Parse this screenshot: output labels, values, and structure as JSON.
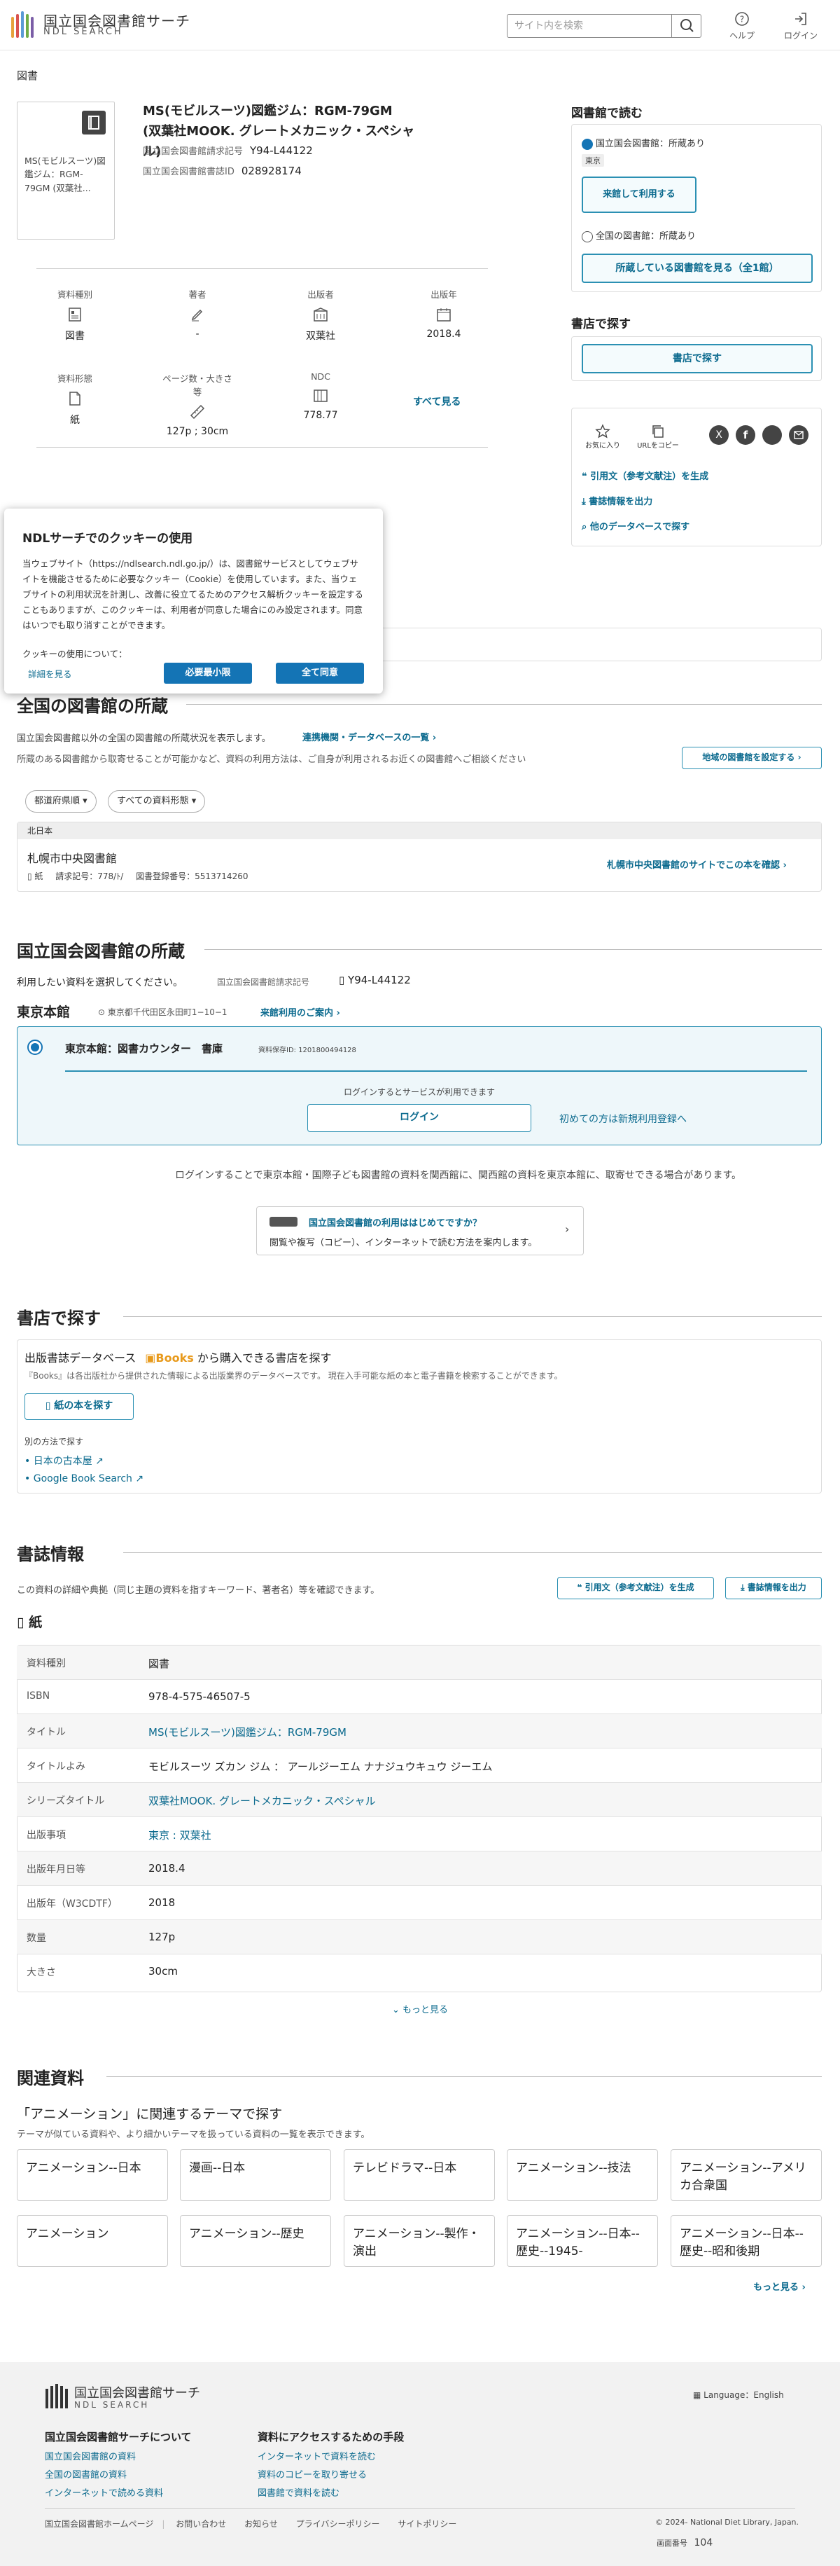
{
  "header": {
    "logo_jp": "国立国会図書館サーチ",
    "logo_en": "NDL SEARCH",
    "search_placeholder": "サイト内を検索",
    "help": "ヘルプ",
    "login": "ログイン"
  },
  "breadcrumb": "図書",
  "book": {
    "cover_text": "MS(モビルスーツ)図鑑ジム：RGM-79GM (双葉社...",
    "title_line1": "MS(モビルスーツ)図鑑ジム：RGM-79GM",
    "title_line2": "(双葉社MOOK. グレートメカニック・スペシャル)",
    "call_label": "国立国会図書館請求記号",
    "call_value": "Y94-L44122",
    "bib_label": "国立国会図書館書誌ID",
    "bib_value": "028928174",
    "attrs": [
      {
        "label": "資料種別",
        "value": "図書",
        "icon": "book-type-icon"
      },
      {
        "label": "著者",
        "value": "-",
        "icon": "pen-icon"
      },
      {
        "label": "出版者",
        "value": "双葉社",
        "icon": "building-icon"
      },
      {
        "label": "出版年",
        "value": "2018.4",
        "icon": "calendar-icon"
      },
      {
        "label": "資料形態",
        "value": "紙",
        "icon": "paper-icon"
      },
      {
        "label": "ページ数・大きさ等",
        "value": "127p ; 30cm",
        "icon": "ruler-icon"
      },
      {
        "label": "NDC",
        "value": "778.77",
        "icon": "ndc-icon"
      }
    ],
    "see_all": "すべて見る"
  },
  "right": {
    "read_heading": "図書館で読む",
    "ndl_label": "国立国会図書館：所蔵あり",
    "tokyo_tag": "東京",
    "visit_btn": "来館して利用する",
    "all_label": "全国の図書館：所蔵あり",
    "all_btn": "所蔵している図書館を見る（全1館）",
    "shop_heading": "書店で探す",
    "shop_btn": "書店で探す",
    "fav": "お気に入り",
    "url_copy": "URLをコピー",
    "cite": "引用文（参考文献注）を生成",
    "export": "書誌情報を出力",
    "other_db": "他のデータベースで探す"
  },
  "cookie": {
    "title": "NDLサーチでのクッキーの使用",
    "body": "当ウェブサイト（https://ndlsearch.ndl.go.jp/）は、図書館サービスとしてウェブサイトを機能させるために必要なクッキー（Cookie）を使用しています。また、当ウェブサイトの利用状況を計測し、改善に役立てるためのアクセス解析クッキーを設定することもありますが、このクッキーは、利用者が同意した場合にのみ設定されます。同意はいつでも取り消すことができます。",
    "about": "クッキーの使用について：",
    "more": "詳細を見る",
    "min_btn": "必要最小限",
    "all_btn": "全て同意"
  },
  "national": {
    "heading": "全国の図書館の所蔵",
    "desc": "国立国会図書館以外の全国の図書館の所蔵状況を表示します。",
    "coop_link": "連携機関・データベースの一覧",
    "note": "所蔵のある図書館から取寄せることが可能かなど、資料の利用方法は、ご自身が利用されるお近くの図書館へご相談ください",
    "region_btn": "地域の図書館を設定する",
    "filter_pref": "都道府県順",
    "filter_type": "すべての資料形態",
    "region": "北日本",
    "lib_name": "札幌市中央図書館",
    "lib_form": "紙",
    "lib_call_label": "請求記号：",
    "lib_call": "778/ﾄ/",
    "lib_reg_label": "図書登録番号：",
    "lib_reg": "5513714260",
    "lib_link": "札幌市中央図書館のサイトでこの本を確認"
  },
  "ndl": {
    "heading": "国立国会図書館の所蔵",
    "select": "利用したい資料を選択してください。",
    "call_label": "国立国会図書館請求記号",
    "call_value": "Y94-L44122",
    "branch": "東京本館",
    "address": "東京都千代田区永田町1−10−1",
    "visit_guide": "来館利用のご案内",
    "counter": "東京本館：図書カウンター　書庫",
    "item_id": "資料保存ID: 1201800494128",
    "login_note": "ログインするとサービスが利用できます",
    "login_btn": "ログイン",
    "register": "初めての方は新規利用登録へ",
    "kansai_note": "ログインすることで東京本館・国際子ども図書館の資料を関西館に、関西館の資料を東京本館に、取寄せできる場合があります。",
    "first_title": "国立国会図書館の利用ははじめてですか？",
    "first_desc": "閲覧や複写（コピー）、インターネットで読む方法を案内します。"
  },
  "shop": {
    "heading": "書店で探す",
    "db_title_pre": "出版書誌データベース",
    "books_logo": "Books",
    "db_title_post": "から購入できる書店を探す",
    "db_desc": "『Books』は各出版社から提供された情報による出版業界のデータベースです。 現在入手可能な紙の本と電子書籍を検索することができます。",
    "paper_btn": "紙の本を探す",
    "other_ways": "別の方法で探す",
    "kosho": "日本の古本屋",
    "gbook": "Google Book Search"
  },
  "biblio": {
    "heading": "書誌情報",
    "desc": "この資料の詳細や典拠（同じ主題の資料を指すキーワード、著者名）等を確認できます。",
    "cite_btn": "引用文（参考文献注）を生成",
    "export_btn": "書誌情報を出力",
    "form": "紙",
    "rows": [
      {
        "k": "資料種別",
        "v": "図書",
        "link": false
      },
      {
        "k": "ISBN",
        "v": "978-4-575-46507-5",
        "link": false
      },
      {
        "k": "タイトル",
        "v": "MS(モビルスーツ)図鑑ジム：RGM-79GM",
        "link": true
      },
      {
        "k": "タイトルよみ",
        "v": "モビルスーツ ズカン ジム ： アールジーエム ナナジュウキュウ ジーエム",
        "link": false
      },
      {
        "k": "シリーズタイトル",
        "v": "双葉社MOOK. グレートメカニック・スペシャル",
        "link": true
      },
      {
        "k": "出版事項",
        "v": "東京 : 双葉社",
        "link": true
      },
      {
        "k": "出版年月日等",
        "v": "2018.4",
        "link": false
      },
      {
        "k": "出版年（W3CDTF）",
        "v": "2018",
        "link": false
      },
      {
        "k": "数量",
        "v": "127p",
        "link": false
      },
      {
        "k": "大きさ",
        "v": "30cm",
        "link": false
      }
    ],
    "more": "もっと見る"
  },
  "related": {
    "heading": "関連資料",
    "sub": "「アニメーション」に関連するテーマで探す",
    "desc": "テーマが似ている資料や、より細かいテーマを扱っている資料の一覧を表示できます。",
    "themes": [
      "アニメーション--日本",
      "漫画--日本",
      "テレビドラマ--日本",
      "アニメーション--技法",
      "アニメーション--アメリカ合衆国",
      "アニメーション",
      "アニメーション--歴史",
      "アニメーション--製作・演出",
      "アニメーション--日本--歴史--1945-",
      "アニメーション--日本--歴史--昭和後期"
    ],
    "more": "もっと見る"
  },
  "footer": {
    "logo_jp": "国立国会図書館サーチ",
    "logo_en": "NDL SEARCH",
    "language": "Language：English",
    "col1_h": "国立国会図書館サーチについて",
    "col1": [
      "国立国会図書館の資料",
      "全国の図書館の資料",
      "インターネットで読める資料"
    ],
    "col2_h": "資料にアクセスするための手段",
    "col2": [
      "インターネットで資料を読む",
      "資料のコピーを取り寄せる",
      "図書館で資料を読む"
    ],
    "bottom": [
      "国立国会図書館ホームページ",
      "お問い合わせ",
      "お知らせ",
      "プライバシーポリシー",
      "サイトポリシー"
    ],
    "copyright": "© 2024- National Diet Library, Japan.",
    "screen_label": "画面番号",
    "screen_no": "104"
  },
  "colors": {
    "accent": "#0b6a8e",
    "button": "#1474b5",
    "panel_border": "#2b90b3"
  }
}
